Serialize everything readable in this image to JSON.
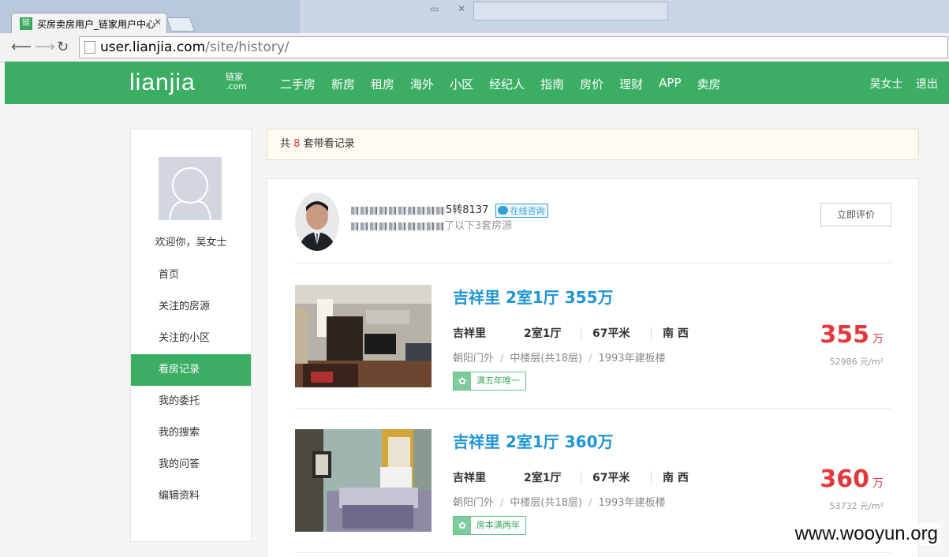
{
  "browser": {
    "tab_title": "买房卖房用户_链家用户中心",
    "favicon_text": "链",
    "url_host": "user.lianjia.com",
    "url_path": "/site/history/"
  },
  "header": {
    "logo": "LIANJIA",
    "logo_sub_1": "链家",
    "logo_sub_2": ".com",
    "nav": [
      "二手房",
      "新房",
      "租房",
      "海外",
      "小区",
      "经纪人",
      "指南",
      "房价",
      "理财",
      "APP",
      "卖房"
    ],
    "user_name": "吴女士",
    "logout": "退出",
    "brand_color": "#3bae64"
  },
  "sidebar": {
    "welcome": "欢迎你，吴女士",
    "items": [
      {
        "label": "首页",
        "active": false
      },
      {
        "label": "关注的房源",
        "active": false
      },
      {
        "label": "关注的小区",
        "active": false
      },
      {
        "label": "看房记录",
        "active": true
      },
      {
        "label": "我的委托",
        "active": false
      },
      {
        "label": "我的搜索",
        "active": false
      },
      {
        "label": "我的问答",
        "active": false
      },
      {
        "label": "编辑资料",
        "active": false
      }
    ]
  },
  "notice": {
    "prefix": "共",
    "count": "8",
    "suffix": "套带看记录"
  },
  "agent": {
    "phone_suffix": "5转8137",
    "consult_label": "在线咨询",
    "visit_text": "了以下3套房源",
    "rate_button": "立即评价"
  },
  "houses": [
    {
      "title": "吉祥里 2室1厅 355万",
      "community": "吉祥里",
      "layout": "2室1厅",
      "area": "67平米",
      "orientation": "南 西",
      "region": "朝阳门外",
      "floor": "中楼层(共18层)",
      "built": "1993年建板楼",
      "tag": "满五年唯一",
      "price": "355",
      "price_unit": "万",
      "unit_price": "52986 元/m²"
    },
    {
      "title": "吉祥里 2室1厅 360万",
      "community": "吉祥里",
      "layout": "2室1厅",
      "area": "67平米",
      "orientation": "南 西",
      "region": "朝阳门外",
      "floor": "中楼层(共18层)",
      "built": "1993年建板楼",
      "tag": "房本满两年",
      "price": "360",
      "price_unit": "万",
      "unit_price": "53732 元/m²"
    }
  ],
  "watermark": "www.wooyun.org"
}
